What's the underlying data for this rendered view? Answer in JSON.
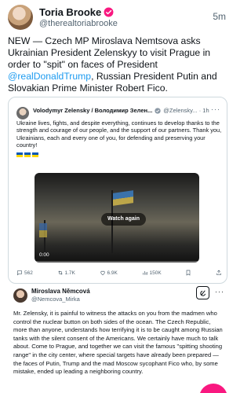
{
  "post": {
    "author_name": "Toria Brooke",
    "author_handle": "@therealtoriabrooke",
    "time": "5m",
    "text_before_mention1": "NEW — Czech MP Miroslava Nemtsova asks Ukrainian President Zelenskyy to visit Prague in order to \"spit\" on faces of President ",
    "mention1": "@realDonaldTrump",
    "text_after_mention1": ", Russian President Putin and Slovakian Prime Minister Robert Fico."
  },
  "quote": {
    "name": "Volodymyr Zelensky / Володимир Зелен...",
    "handle": "@Zelensky... · 1h",
    "text": "Ukraine lives, fights, and despite everything, continues to develop thanks to the strength and courage of our people, and the support of our partners. Thank you, Ukrainians, each and every one of you, for defending and preserving your country!",
    "video": {
      "watch_label": "Watch again",
      "time": "0:00"
    },
    "actions": {
      "replies": "562",
      "reposts": "1.7K",
      "likes": "6.9K",
      "views": "150K"
    }
  },
  "embedded": {
    "name": "Miroslava Němcová",
    "handle": "@Nemcova_Mirka",
    "text": "Mr. Zelensky, it is painful to witness the attacks on you from the madmen who control the nuclear button on both sides of the ocean. The Czech Republic, more than anyone, understands how terrifying it is to be caught among Russian tanks with the silent consent of the Americans. We certainly have much to talk about. Come to Prague, and together we can visit the famous \"spitting shooting range\" in the city center, where special targets have already been prepared — the faces of Putin, Trump and the mad Moscow sycophant Fico who, by some mistake, ended up leading a neighboring country."
  },
  "colors": {
    "link": "#1d9bf0",
    "verified": "#f91880",
    "muted": "#536471",
    "fab": "#f91880"
  }
}
